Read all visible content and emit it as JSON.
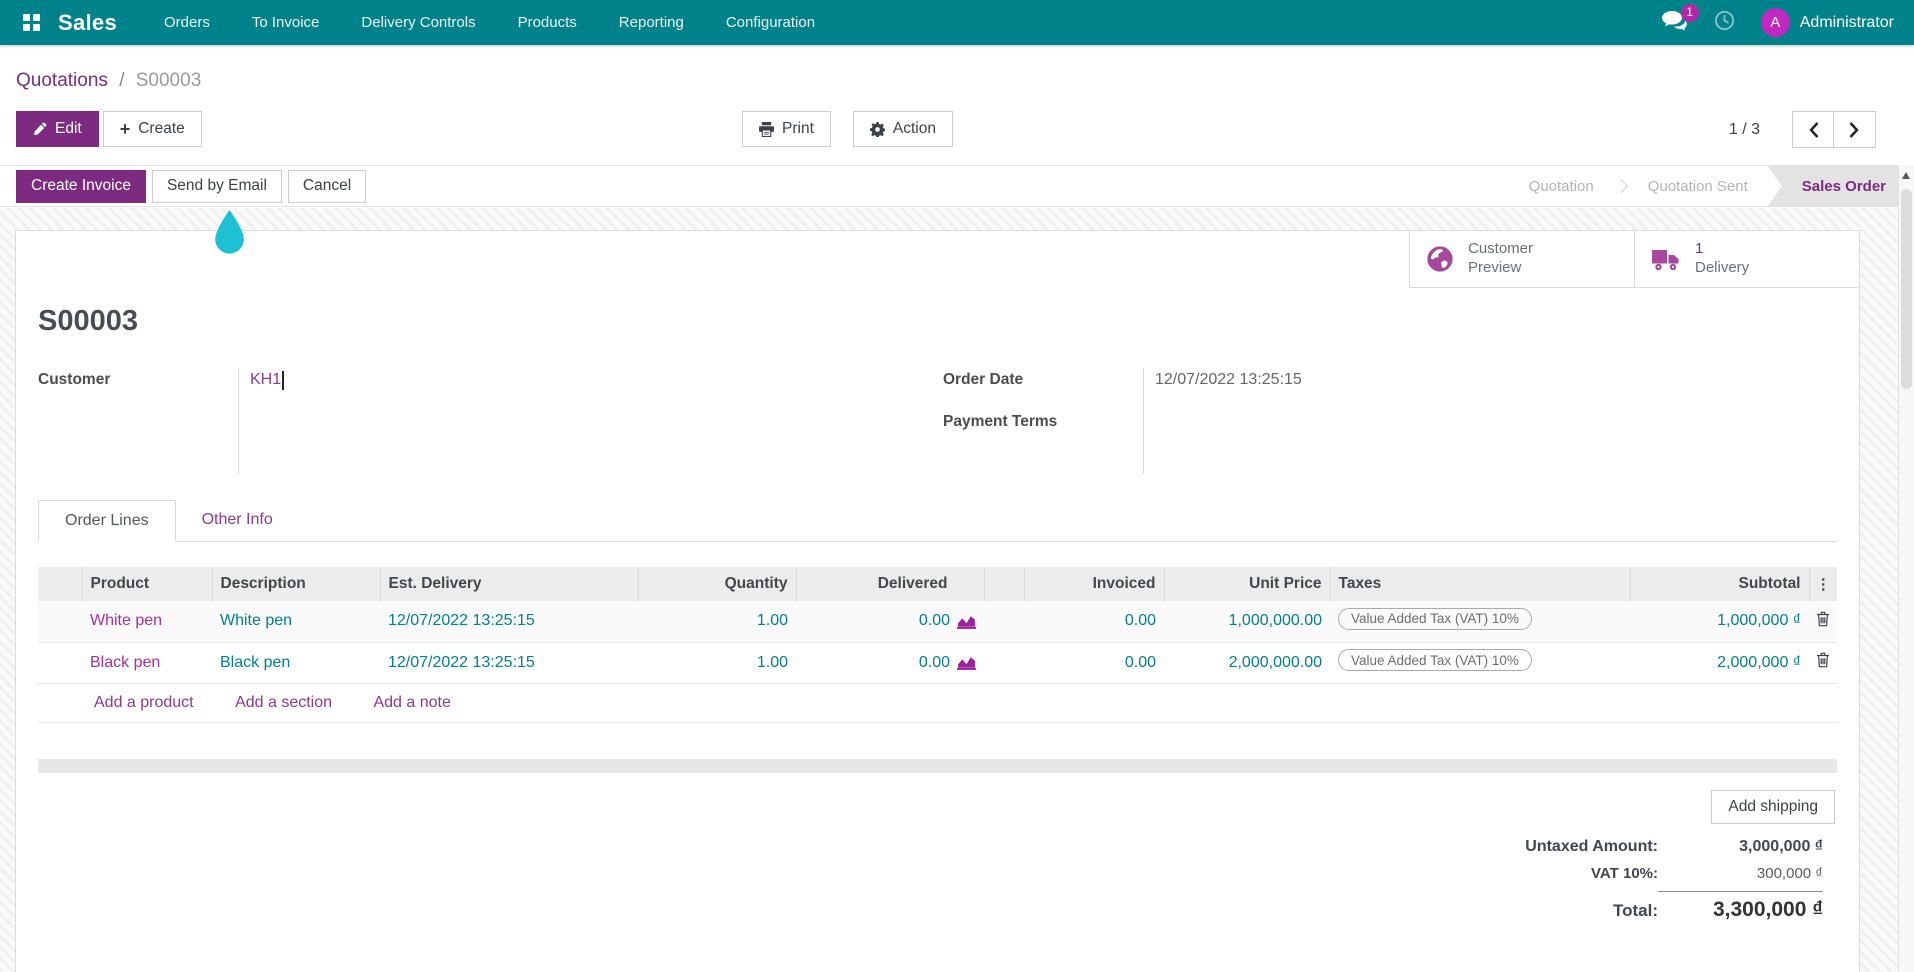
{
  "navbar": {
    "app_name": "Sales",
    "menus": [
      "Orders",
      "To Invoice",
      "Delivery Controls",
      "Products",
      "Reporting",
      "Configuration"
    ],
    "messages_badge": "1",
    "user_initial": "A",
    "user_name": "Administrator"
  },
  "breadcrumb": {
    "parent": "Quotations",
    "separator": "/",
    "current": "S00003"
  },
  "control_panel": {
    "edit_label": "Edit",
    "create_label": "Create",
    "print_label": "Print",
    "action_label": "Action",
    "pager_text": "1 / 3"
  },
  "statusbar": {
    "buttons": [
      "Create Invoice",
      "Send by Email",
      "Cancel"
    ],
    "stages": [
      "Quotation",
      "Quotation Sent",
      "Sales Order"
    ],
    "active_stage": "Sales Order"
  },
  "smart_buttons": {
    "customer_preview": {
      "line1": "Customer",
      "line2": "Preview",
      "icon": "globe-icon"
    },
    "delivery": {
      "count": "1",
      "label": "Delivery",
      "icon": "truck-icon"
    }
  },
  "sheet": {
    "title": "S00003",
    "fields": {
      "customer_label": "Customer",
      "customer_value": "KH1",
      "order_date_label": "Order Date",
      "order_date_value": "12/07/2022 13:25:15",
      "payment_terms_label": "Payment Terms",
      "payment_terms_value": ""
    },
    "tabs": [
      {
        "label": "Order Lines",
        "active": true
      },
      {
        "label": "Other Info",
        "active": false
      }
    ]
  },
  "order_lines": {
    "headers": {
      "product": "Product",
      "description": "Description",
      "est_delivery": "Est. Delivery",
      "quantity": "Quantity",
      "delivered": "Delivered",
      "invoiced": "Invoiced",
      "unit_price": "Unit Price",
      "taxes": "Taxes",
      "subtotal": "Subtotal",
      "options_icon": "⋮"
    },
    "rows": [
      {
        "product": "White pen",
        "description": "White pen",
        "est_delivery": "12/07/2022 13:25:15",
        "quantity": "1.00",
        "delivered": "0.00",
        "invoiced": "0.00",
        "unit_price": "1,000,000.00",
        "taxes": "Value Added Tax (VAT) 10%",
        "subtotal": "1,000,000 ₫"
      },
      {
        "product": "Black pen",
        "description": "Black pen",
        "est_delivery": "12/07/2022 13:25:15",
        "quantity": "1.00",
        "delivered": "0.00",
        "invoiced": "0.00",
        "unit_price": "2,000,000.00",
        "taxes": "Value Added Tax (VAT) 10%",
        "subtotal": "2,000,000 ₫"
      }
    ],
    "footer_links": [
      "Add a product",
      "Add a section",
      "Add a note"
    ]
  },
  "totals": {
    "add_shipping_label": "Add shipping",
    "untaxed_label": "Untaxed Amount:",
    "untaxed_value": "3,000,000 ₫",
    "vat_label": "VAT 10%:",
    "vat_value": "300,000 ₫",
    "total_label": "Total:",
    "total_value": "3,300,000 ₫"
  },
  "icons": {
    "plus": "+"
  },
  "colors": {
    "navbar_teal": "#00828b",
    "primary_purple": "#7c2b80",
    "link_purple": "#8a3a90",
    "product_magenta": "#a3309b",
    "value_teal": "#01808a",
    "smart_icon_magenta": "#a5489e",
    "droplet_cyan": "#1ec0d4",
    "badge_magenta": "#b327a6",
    "avatar_magenta": "#c127c1"
  }
}
